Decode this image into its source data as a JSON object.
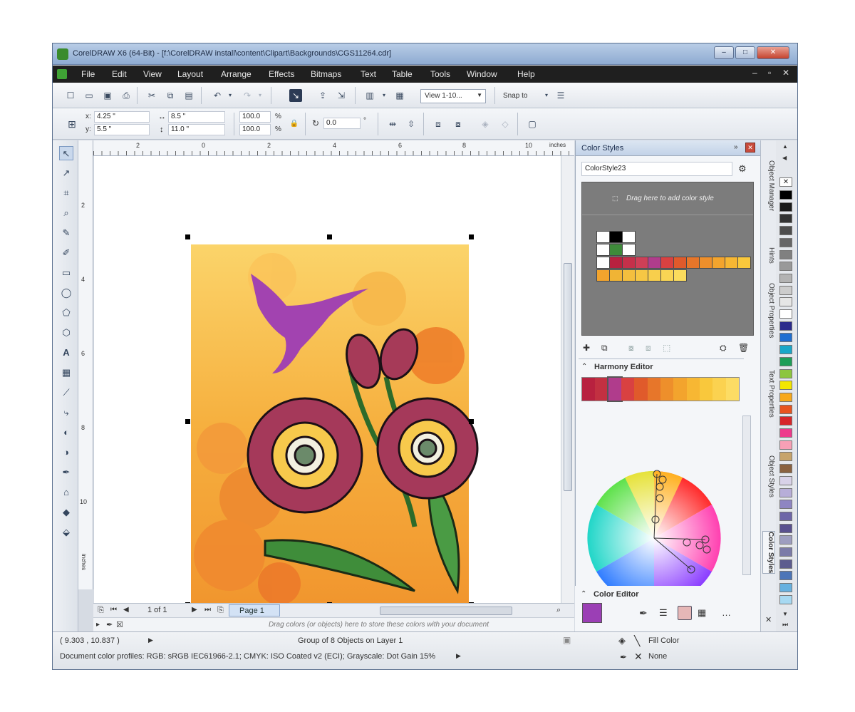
{
  "window": {
    "title": "CorelDRAW X6 (64-Bit) - [f:\\CorelDRAW install\\content\\Clipart\\Backgrounds\\CGS11264.cdr]",
    "controls": [
      "–",
      "□",
      "✕"
    ]
  },
  "menu": [
    "File",
    "Edit",
    "View",
    "Layout",
    "Arrange",
    "Effects",
    "Bitmaps",
    "Text",
    "Table",
    "Tools",
    "Window",
    "Help"
  ],
  "standard_toolbar": {
    "view_dropdown": "View 1-10...",
    "snap_to": "Snap to"
  },
  "property_bar": {
    "x_label": "x:",
    "x_value": "4.25 \"",
    "y_label": "y:",
    "y_value": "5.5 \"",
    "width_value": "8.5 \"",
    "height_value": "11.0 \"",
    "scale_x": "100.0",
    "scale_y": "100.0",
    "percent": "%",
    "rotation": "0.0",
    "degree": "°"
  },
  "ruler": {
    "unit": "inches",
    "h_ticks": [
      "2",
      "0",
      "2",
      "4",
      "6",
      "8",
      "10"
    ],
    "v_ticks": [
      "2",
      "4",
      "6",
      "8",
      "10"
    ],
    "v_unit": "inches"
  },
  "page_nav": {
    "page_count": "1 of 1",
    "page_tab": "Page 1"
  },
  "palette_hint": "Drag colors (or objects) here to store these colors with your document",
  "status": {
    "coords": "( 9.303 , 10.837 )",
    "selection": "Group of 8 Objects on Layer 1",
    "profiles": "Document color profiles: RGB: sRGB IEC61966-2.1; CMYK: ISO Coated v2 (ECI); Grayscale: Dot Gain 15%",
    "fill_label": "Fill Color",
    "outline_label": "None"
  },
  "docker": {
    "title": "Color Styles",
    "style_name": "ColorStyle23",
    "drop_hint": "Drag here to add color style",
    "harmony_title": "Harmony Editor",
    "color_editor_title": "Color Editor",
    "swatch_rows": [
      [
        "#ffffff",
        "#000000",
        "#ffffff"
      ],
      [
        "#ffffff",
        "#3e8a3a",
        "#ffffff"
      ],
      [
        "#ffffff",
        "#b8213f",
        "#c6304a",
        "#cf3f57",
        "#b03c8c",
        "#d94141",
        "#e05a2b",
        "#e7762a",
        "#ee8f2b",
        "#f3a42d",
        "#f7b733",
        "#f9c83c"
      ],
      [
        "#f3a42d",
        "#f0b435",
        "#f4bf3e",
        "#f6c744",
        "#f8cf4c",
        "#f9d554",
        "#fbdc5d"
      ]
    ],
    "harmony_colors": [
      "#b8213f",
      "#c23041",
      "#b03c8c",
      "#d94141",
      "#e05a2b",
      "#e7762a",
      "#ee8f2b",
      "#f3a42d",
      "#f7b733",
      "#f9c83c",
      "#fbd250",
      "#fcdc64"
    ],
    "editor_swatch": "#9b3fb5"
  },
  "docker_tabs": [
    "Object Manager",
    "Hints",
    "Object Properties",
    "Text Properties",
    "Object Styles",
    "Color Styles"
  ],
  "color_palette": [
    "#000000",
    "#1a1a1a",
    "#333333",
    "#4d4d4d",
    "#666666",
    "#808080",
    "#999999",
    "#b3b3b3",
    "#cccccc",
    "#e6e6e6",
    "#ffffff",
    "#2b2b8c",
    "#1f6fd1",
    "#19a7c9",
    "#1d9e58",
    "#8cc63f",
    "#f3e600",
    "#f7a81b",
    "#e8541f",
    "#d7262b",
    "#ee3a8c",
    "#f7a0b6",
    "#c7a46b",
    "#8a6240",
    "#d8d2e8",
    "#b7aed8",
    "#8e85c2",
    "#6e66a8",
    "#59508f",
    "#9d9dc0",
    "#7b7ba8",
    "#5c5c8f",
    "#4c75b8",
    "#67b1e0",
    "#a7d9f2"
  ]
}
